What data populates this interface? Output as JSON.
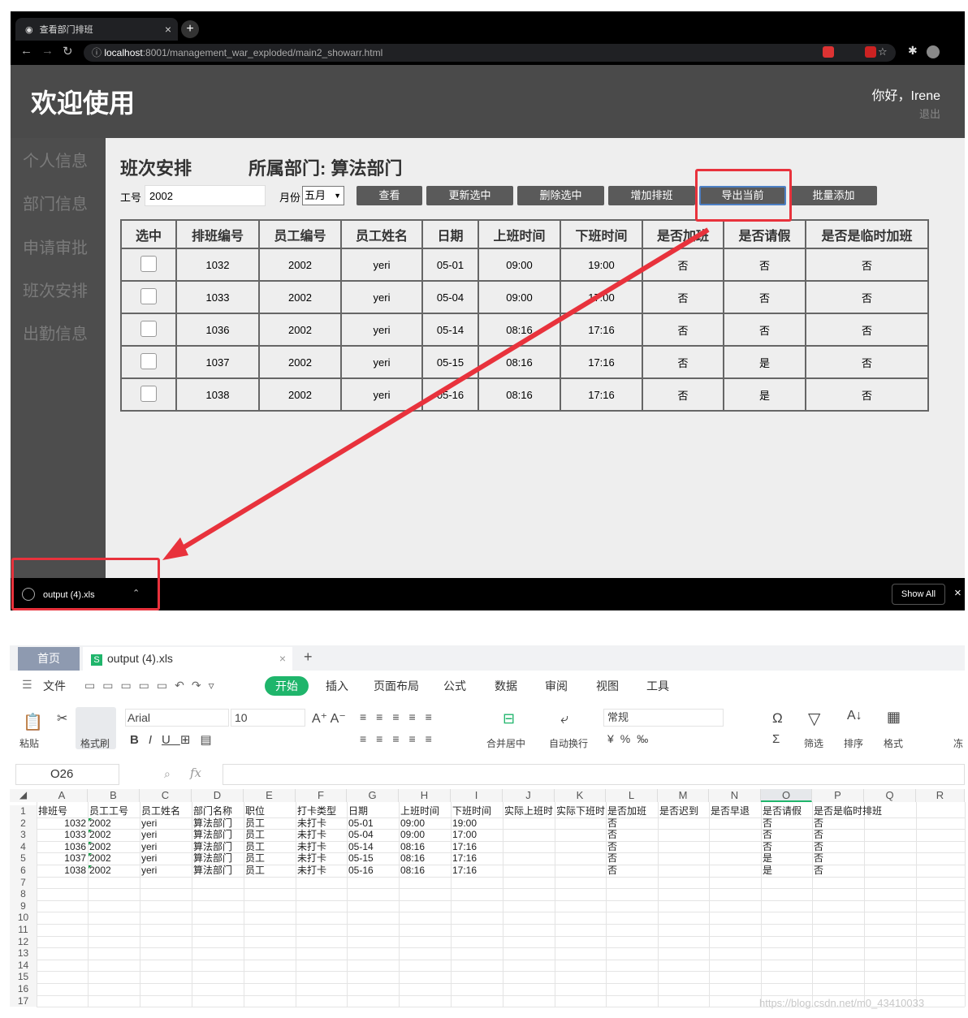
{
  "browser": {
    "tab_title": "查看部门排班",
    "url_host": "localhost",
    "url_rest": ":8001/management_war_exploded/main2_showarr.html"
  },
  "header": {
    "title": "欢迎使用",
    "greeting": "你好，Irene",
    "logout": "退出"
  },
  "sidebar": {
    "items": [
      "个人信息",
      "部门信息",
      "申请审批",
      "班次安排",
      "出勤信息"
    ]
  },
  "main": {
    "title": "班次安排",
    "dept": "所属部门: 算法部门",
    "emp_label": "工号",
    "emp_value": "2002",
    "month_label": "月份",
    "month_value": "五月",
    "buttons": [
      "查看",
      "更新选中",
      "删除选中",
      "增加排班",
      "导出当前",
      "批量添加"
    ],
    "columns": [
      "选中",
      "排班编号",
      "员工编号",
      "员工姓名",
      "日期",
      "上班时间",
      "下班时间",
      "是否加班",
      "是否请假",
      "是否是临时加班"
    ],
    "rows": [
      [
        "1032",
        "2002",
        "yeri",
        "05-01",
        "09:00",
        "19:00",
        "否",
        "否",
        "否"
      ],
      [
        "1033",
        "2002",
        "yeri",
        "05-04",
        "09:00",
        "17:00",
        "否",
        "否",
        "否"
      ],
      [
        "1036",
        "2002",
        "yeri",
        "05-14",
        "08:16",
        "17:16",
        "否",
        "否",
        "否"
      ],
      [
        "1037",
        "2002",
        "yeri",
        "05-15",
        "08:16",
        "17:16",
        "否",
        "是",
        "否"
      ],
      [
        "1038",
        "2002",
        "yeri",
        "05-16",
        "08:16",
        "17:16",
        "否",
        "是",
        "否"
      ]
    ]
  },
  "download": {
    "file": "output (4).xls",
    "show_all": "Show All"
  },
  "annotation_color": "#e8323c",
  "wps": {
    "home_tab": "首页",
    "file_tab": "output (4).xls",
    "menu": [
      "文件",
      "开始",
      "插入",
      "页面布局",
      "公式",
      "数据",
      "审阅",
      "视图",
      "工具"
    ],
    "ribbon": {
      "paste": "粘贴",
      "format_painter": "格式刷",
      "font": "Arial",
      "size": "10",
      "merge": "合并居中",
      "wrap": "自动换行",
      "number_format": "常规",
      "filter": "筛选",
      "sort": "排序",
      "format": "格式",
      "freeze": "冻"
    },
    "cell_ref": "O26",
    "fx": "fx",
    "col_letters": [
      "A",
      "B",
      "C",
      "D",
      "E",
      "F",
      "G",
      "H",
      "I",
      "J",
      "K",
      "L",
      "M",
      "N",
      "O",
      "P",
      "Q",
      "R"
    ],
    "sheet_header": [
      "排班号",
      "员工工号",
      "员工姓名",
      "部门名称",
      "职位",
      "打卡类型",
      "日期",
      "上班时间",
      "下班时间",
      "实际上班时",
      "实际下班时",
      "是否加班",
      "是否迟到",
      "是否早退",
      "是否请假",
      "是否是临时排班",
      "",
      ""
    ],
    "sheet_rows": [
      [
        "1032",
        "2002",
        "yeri",
        "算法部门",
        "员工",
        "未打卡",
        "05-01",
        "09:00",
        "19:00",
        "",
        "",
        "否",
        "",
        "",
        "否",
        "否"
      ],
      [
        "1033",
        "2002",
        "yeri",
        "算法部门",
        "员工",
        "未打卡",
        "05-04",
        "09:00",
        "17:00",
        "",
        "",
        "否",
        "",
        "",
        "否",
        "否"
      ],
      [
        "1036",
        "2002",
        "yeri",
        "算法部门",
        "员工",
        "未打卡",
        "05-14",
        "08:16",
        "17:16",
        "",
        "",
        "否",
        "",
        "",
        "否",
        "否"
      ],
      [
        "1037",
        "2002",
        "yeri",
        "算法部门",
        "员工",
        "未打卡",
        "05-15",
        "08:16",
        "17:16",
        "",
        "",
        "否",
        "",
        "",
        "是",
        "否"
      ],
      [
        "1038",
        "2002",
        "yeri",
        "算法部门",
        "员工",
        "未打卡",
        "05-16",
        "08:16",
        "17:16",
        "",
        "",
        "否",
        "",
        "",
        "是",
        "否"
      ]
    ],
    "row_count": 17,
    "accent": "#1fb56b"
  },
  "watermark": "https://blog.csdn.net/m0_43410033"
}
